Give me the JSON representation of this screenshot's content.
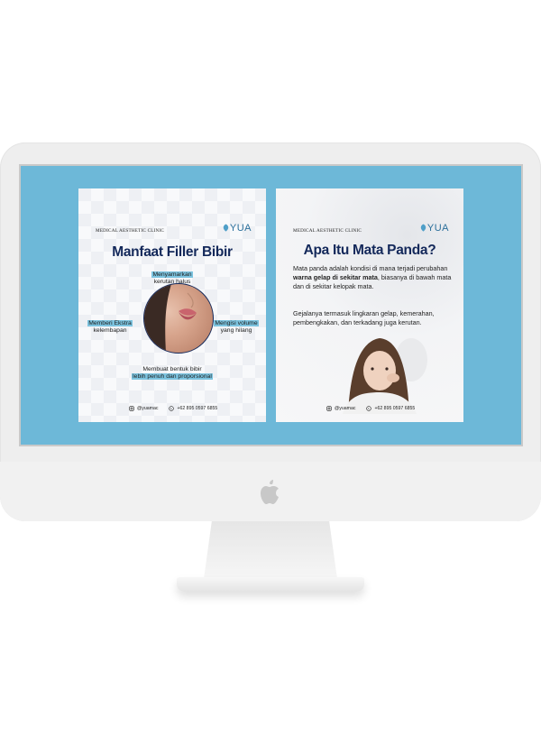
{
  "colors": {
    "screen": "#6db8d8",
    "title": "#13285a",
    "highlight": "#7cc4e0"
  },
  "left_post": {
    "clinic": "MEDICAL AESTHETIC CLINIC",
    "logo": "YUA",
    "title": "Manfaat Filler Bibir",
    "label_top_1": "Menyamarkan",
    "label_top_2": "kerutan halus",
    "label_left_1": "Memberi Ekstra",
    "label_left_2": "kelembapan",
    "label_right_1": "Mengisi volume",
    "label_right_2": "yang hilang",
    "label_bottom_1": "Membuat bentuk bibir",
    "label_bottom_2": "lebih penuh dan proporsional",
    "instagram": "@yuamac",
    "whatsapp": "+62 895 0597 6855"
  },
  "right_post": {
    "clinic": "MEDICAL AESTHETIC CLINIC",
    "logo": "YUA",
    "title": "Apa Itu Mata Panda?",
    "para1_a": "Mata panda adalah kondisi di mana terjadi perubahan ",
    "para1_bold": "warna gelap di sekitar mata",
    "para1_b": ", biasanya di bawah mata dan di sekitar kelopak mata.",
    "para2": "Gejalanya termasuk lingkaran gelap, kemerahan, pembengkakan, dan terkadang juga kerutan.",
    "instagram": "@yuamac",
    "whatsapp": "+62 895 0597 6855"
  }
}
